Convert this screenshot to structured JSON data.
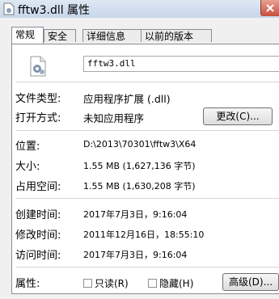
{
  "window": {
    "title": "fftw3.dll 属性"
  },
  "tabs": [
    {
      "label": "常规",
      "active": true
    },
    {
      "label": "安全",
      "active": false
    },
    {
      "label": "详细信息",
      "active": false
    },
    {
      "label": "以前的版本",
      "active": false
    }
  ],
  "general": {
    "file_name": "fftw3.dll",
    "file_type_label": "文件类型:",
    "file_type_value": "应用程序扩展 (.dll)",
    "open_with_label": "打开方式:",
    "open_with_value": "未知应用程序",
    "change_button": "更改(C)...",
    "location_label": "位置:",
    "location_value": "D:\\2013\\70301\\fftw3\\X64",
    "size_label": "大小:",
    "size_value": "1.55 MB (1,627,136 字节)",
    "size_on_disk_label": "占用空间:",
    "size_on_disk_value": "1.55 MB (1,630,208 字节)",
    "created_label": "创建时间:",
    "created_value": "2017年7月3日，9:16:04",
    "modified_label": "修改时间:",
    "modified_value": "2011年12月16日，18:55:10",
    "accessed_label": "访问时间:",
    "accessed_value": "2017年7月3日，9:16:04",
    "attributes_label": "属性:",
    "readonly_label": "只读(R)",
    "readonly_checked": false,
    "hidden_label": "隐藏(H)",
    "hidden_checked": false,
    "advanced_button": "高级(D)..."
  },
  "icons": {
    "title": "dll-file-icon",
    "file": "dll-gear-file-icon",
    "close": "close-icon"
  }
}
